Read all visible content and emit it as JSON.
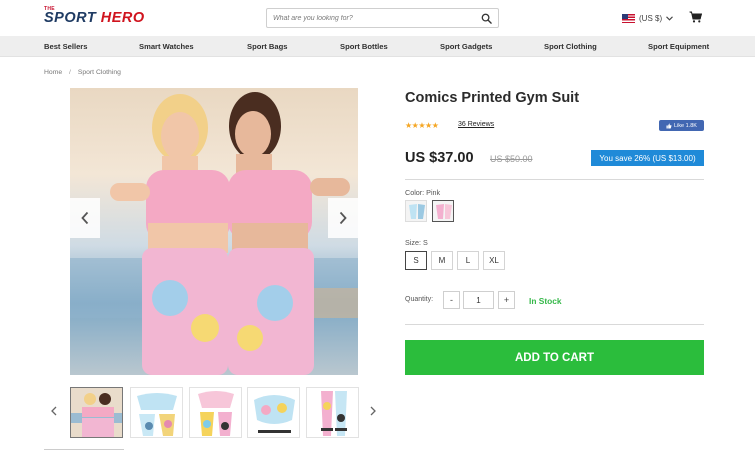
{
  "header": {
    "logo_small": "THE",
    "logo_word1": "SPORT",
    "logo_word2": "HERO",
    "search_placeholder": "What are you looking for?",
    "currency": "(US $)",
    "icons": [
      "search-icon",
      "flag-us-icon",
      "chevron-down-icon",
      "cart-icon"
    ]
  },
  "nav": {
    "items": [
      "Best Sellers",
      "Smart Watches",
      "Sport Bags",
      "Sport Bottles",
      "Sport Gadgets",
      "Sport Clothing",
      "Sport Equipment"
    ]
  },
  "breadcrumb": {
    "home": "Home",
    "separator": "/",
    "current": "Sport Clothing"
  },
  "product": {
    "title": "Comics Printed Gym Suit",
    "stars": "★★★★★",
    "rating_stars": 5,
    "reviews": "36 Reviews",
    "fb_like": "Like 1.8K",
    "price": "US $37.00",
    "old_price": "US $50.00",
    "save_text": "You save 26% (US $13.00)",
    "color_label": "Color: Pink",
    "size_label": "Size: S",
    "sizes": [
      "S",
      "M",
      "L",
      "XL"
    ],
    "selected_size": "S",
    "quantity_label": "Quantity:",
    "quantity_minus": "-",
    "quantity_value": "1",
    "quantity_plus": "+",
    "stock": "In Stock",
    "add_to_cart": "ADD TO CART"
  },
  "colors": {
    "accent_green": "#2bbd3c",
    "badge_blue": "#1f8ad8",
    "star_orange": "#f5a623",
    "logo_navy": "#1f3b63",
    "logo_red": "#d0141e"
  }
}
